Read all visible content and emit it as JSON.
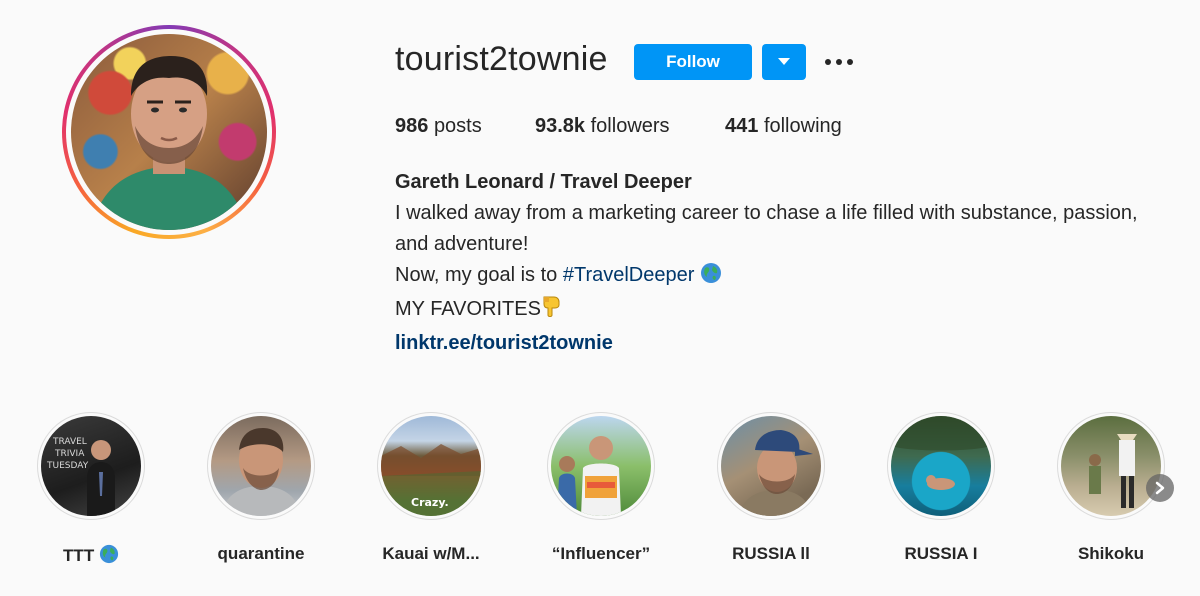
{
  "profile": {
    "username": "tourist2townie",
    "follow_label": "Follow",
    "stats": {
      "posts_count": "986",
      "posts_label": "posts",
      "followers_count": "93.8k",
      "followers_label": "followers",
      "following_count": "441",
      "following_label": "following"
    },
    "bio": {
      "full_name": "Gareth Leonard / Travel Deeper",
      "line1": "I walked away from a marketing career to chase a life filled with substance, passion,",
      "line2": "and adventure!",
      "line3_prefix": "Now, my goal is to ",
      "hashtag": "#TravelDeeper",
      "line4": "MY FAVORITES",
      "link": "linktr.ee/tourist2townie"
    }
  },
  "highlights": [
    {
      "label": "TTT",
      "icon": "globe-icon"
    },
    {
      "label": "quarantine"
    },
    {
      "label": "Kauai w/M..."
    },
    {
      "label": "“Influencer”"
    },
    {
      "label": "RUSSIA ll"
    },
    {
      "label": "RUSSIA I"
    },
    {
      "label": "Shikoku"
    }
  ],
  "highlight_overlay_text": {
    "ttt_board": "TRAVEL TRIVIA TUESDAY",
    "kauai_caption": "Crazy."
  },
  "colors": {
    "accent_blue": "#0095f6",
    "link_blue": "#00376b",
    "text": "#262626",
    "background": "#fafafa"
  }
}
